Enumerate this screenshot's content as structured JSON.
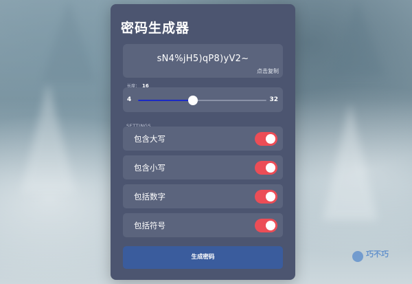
{
  "app": {
    "title": "密码生成器"
  },
  "password": {
    "value": "sN4%jH5)qP8)yV2~",
    "copy_hint": "点击复制"
  },
  "length": {
    "label": "长度：",
    "value": "16",
    "min": "4",
    "max": "32",
    "fraction": 0.428
  },
  "settings": {
    "heading": "SETTINGS",
    "options": [
      {
        "label": "包含大写",
        "enabled": true
      },
      {
        "label": "包含小写",
        "enabled": true
      },
      {
        "label": "包括数字",
        "enabled": true
      },
      {
        "label": "包括符号",
        "enabled": true
      }
    ]
  },
  "generate_button": {
    "label": "生成密码"
  },
  "colors": {
    "card": "#4c5570",
    "panel": "#5b647d",
    "toggle_on": "#ec4d56",
    "slider_fill": "#1b2ac4",
    "button": "#3a5c9d"
  },
  "watermark": {
    "text": "巧不巧"
  }
}
